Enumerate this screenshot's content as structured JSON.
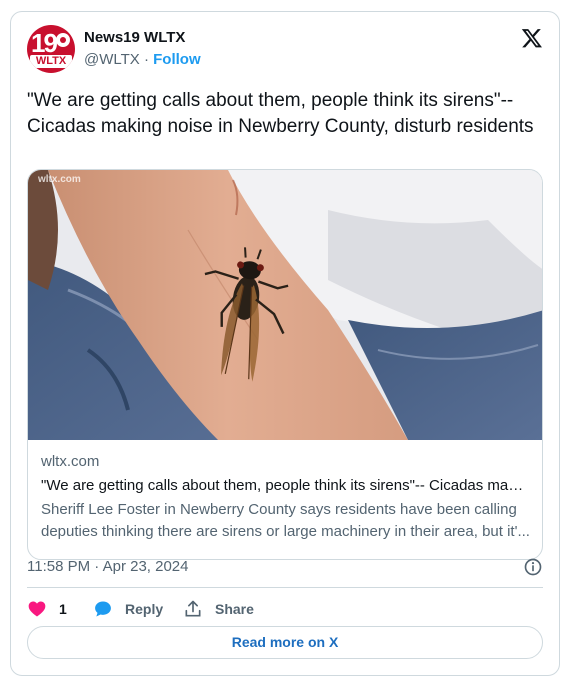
{
  "account": {
    "avatar_num": "19",
    "avatar_callsign": "WLTX",
    "name": "News19 WLTX",
    "handle": "@WLTX",
    "separator": " · ",
    "follow_label": "Follow"
  },
  "tweet": {
    "text": "\"We are getting calls about them, people think its sirens\"-- Cicadas making noise in Newberry County, disturb residents"
  },
  "link_card": {
    "watermark": "wltx.com",
    "domain": "wltx.com",
    "title": "\"We are getting calls about them, people think its sirens\"-- Cicadas maki...",
    "description": "Sheriff Lee Foster in Newberry County says residents have been calling deputies thinking there are sirens or large machinery in their area, but it'..."
  },
  "meta": {
    "timestamp": "11:58 PM · Apr 23, 2024"
  },
  "actions": {
    "like_count": "1",
    "reply_label": "Reply",
    "share_label": "Share"
  },
  "footer": {
    "read_more_label": "Read more on X"
  },
  "colors": {
    "accent": "#1d9bf0",
    "like": "#f91880",
    "border": "#cfd9de",
    "secondary_text": "#536471",
    "brand_red": "#c8102e"
  },
  "icons": [
    "x-logo-icon",
    "info-icon",
    "heart-icon",
    "reply-bubble-icon",
    "share-icon"
  ]
}
